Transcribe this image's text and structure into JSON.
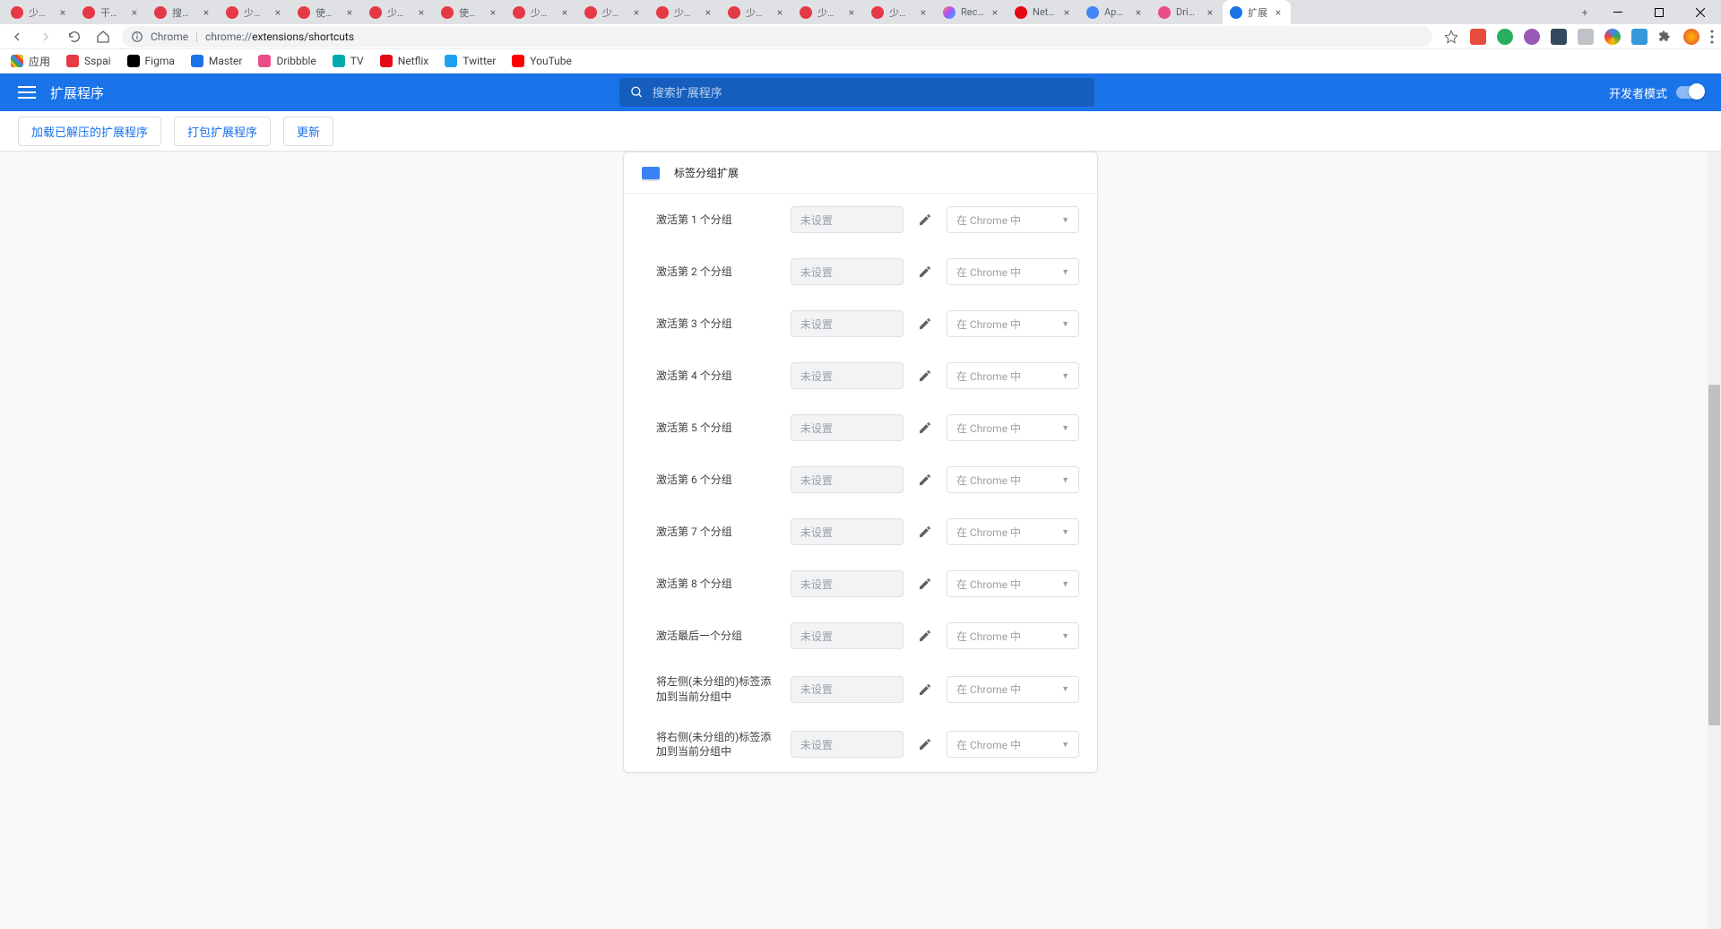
{
  "tabs": [
    {
      "label": "少数...",
      "fav": "fav-red"
    },
    {
      "label": "干掉...",
      "fav": "fav-red"
    },
    {
      "label": "搜索...",
      "fav": "fav-red"
    },
    {
      "label": "少数...",
      "fav": "fav-red"
    },
    {
      "label": "使用...",
      "fav": "fav-red"
    },
    {
      "label": "少数...",
      "fav": "fav-red"
    },
    {
      "label": "使用...",
      "fav": "fav-red"
    },
    {
      "label": "少数...",
      "fav": "fav-red"
    },
    {
      "label": "少数...",
      "fav": "fav-red"
    },
    {
      "label": "少数...",
      "fav": "fav-red"
    },
    {
      "label": "少数...",
      "fav": "fav-red"
    },
    {
      "label": "少数...",
      "fav": "fav-red"
    },
    {
      "label": "少数...",
      "fav": "fav-red"
    },
    {
      "label": "Rece...",
      "fav": "fav-figma"
    },
    {
      "label": "Netf...",
      "fav": "fav-netflix"
    },
    {
      "label": "App...",
      "fav": "fav-blue"
    },
    {
      "label": "Drib...",
      "fav": "fav-pink"
    },
    {
      "label": "扩展",
      "fav": "fav-ext",
      "active": true
    }
  ],
  "url": {
    "chip": "Chrome",
    "host": "chrome://",
    "path": "extensions/shortcuts"
  },
  "bookmarks": [
    {
      "label": "应用",
      "cls": "apps"
    },
    {
      "label": "Sspai",
      "color": "#e63946"
    },
    {
      "label": "Figma",
      "color": "#000"
    },
    {
      "label": "Master",
      "color": "#1a73e8"
    },
    {
      "label": "Dribbble",
      "color": "#ea4c89"
    },
    {
      "label": "TV",
      "color": "#0aa"
    },
    {
      "label": "Netflix",
      "color": "#e50914"
    },
    {
      "label": "Twitter",
      "color": "#1da1f2"
    },
    {
      "label": "YouTube",
      "color": "#ff0000"
    }
  ],
  "header": {
    "title": "扩展程序",
    "search_placeholder": "搜索扩展程序",
    "dev_mode": "开发者模式"
  },
  "toolbar": {
    "load_unpacked": "加载已解压的扩展程序",
    "pack": "打包扩展程序",
    "update": "更新"
  },
  "card": {
    "title": "标签分组扩展",
    "shortcut_placeholder": "未设置",
    "scope_label": "在 Chrome 中",
    "rows": [
      "激活第 1 个分组",
      "激活第 2 个分组",
      "激活第 3 个分组",
      "激活第 4 个分组",
      "激活第 5 个分组",
      "激活第 6 个分组",
      "激活第 7 个分组",
      "激活第 8 个分组",
      "激活最后一个分组",
      "将左侧(未分组的)标签添加到当前分组中",
      "将右侧(未分组的)标签添加到当前分组中"
    ]
  }
}
